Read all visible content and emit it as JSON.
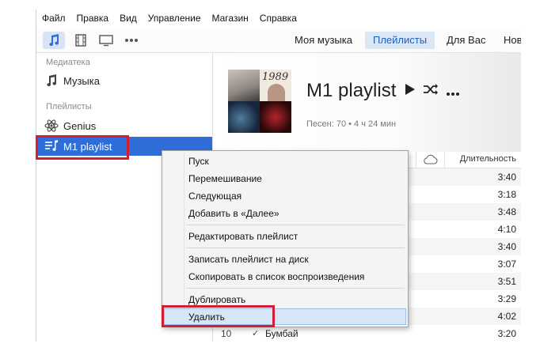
{
  "menubar": [
    "Файл",
    "Правка",
    "Вид",
    "Управление",
    "Магазин",
    "Справка"
  ],
  "toolbar": {
    "icons": [
      "music-note-icon",
      "film-icon",
      "tv-icon",
      "more-dots-icon"
    ],
    "tabs": [
      {
        "label": "Моя музыка",
        "selected": false
      },
      {
        "label": "Плейлисты",
        "selected": true
      },
      {
        "label": "Для Вас",
        "selected": false
      },
      {
        "label": "Нов",
        "selected": false
      }
    ]
  },
  "sidebar": {
    "library_header": "Медиатека",
    "library_items": [
      {
        "label": "Музыка",
        "icon": "music-note-icon"
      }
    ],
    "playlists_header": "Плейлисты",
    "playlist_items": [
      {
        "label": "Genius",
        "icon": "atom-icon",
        "selected": false
      },
      {
        "label": "M1 playlist",
        "icon": "playlist-icon",
        "selected": true
      }
    ]
  },
  "playlist": {
    "title": "M1 playlist",
    "meta": "Песен: 70 • 4 ч 24 мин",
    "art_text": "1989"
  },
  "table": {
    "duration_header": "Длительность",
    "rows": [
      {
        "num": "",
        "check": "",
        "title": "",
        "duration": "3:40"
      },
      {
        "num": "",
        "check": "",
        "title": "",
        "duration": "3:18"
      },
      {
        "num": "",
        "check": "",
        "title": "",
        "duration": "3:48"
      },
      {
        "num": "",
        "check": "",
        "title": "",
        "duration": "4:10"
      },
      {
        "num": "",
        "check": "",
        "title": "",
        "duration": "3:40"
      },
      {
        "num": "",
        "check": "",
        "title": "",
        "duration": "3:07"
      },
      {
        "num": "",
        "check": "",
        "title": "",
        "duration": "3:51"
      },
      {
        "num": "",
        "check": "",
        "title": "",
        "duration": "3:29"
      },
      {
        "num": "",
        "check": "",
        "title": "",
        "duration": "4:02"
      },
      {
        "num": "10",
        "check": "✓",
        "title": "Бумбай",
        "duration": "3:20"
      }
    ]
  },
  "context_menu": {
    "groups": [
      [
        "Пуск",
        "Перемешивание",
        "Следующая",
        "Добавить в «Далее»"
      ],
      [
        "Редактировать плейлист"
      ],
      [
        "Записать плейлист на диск",
        "Скопировать в список воспроизведения"
      ],
      [
        "Дублировать",
        "Удалить"
      ]
    ],
    "highlighted": "Удалить"
  },
  "colors": {
    "accent": "#2f6ed9",
    "highlight_box": "#d21f2f"
  }
}
